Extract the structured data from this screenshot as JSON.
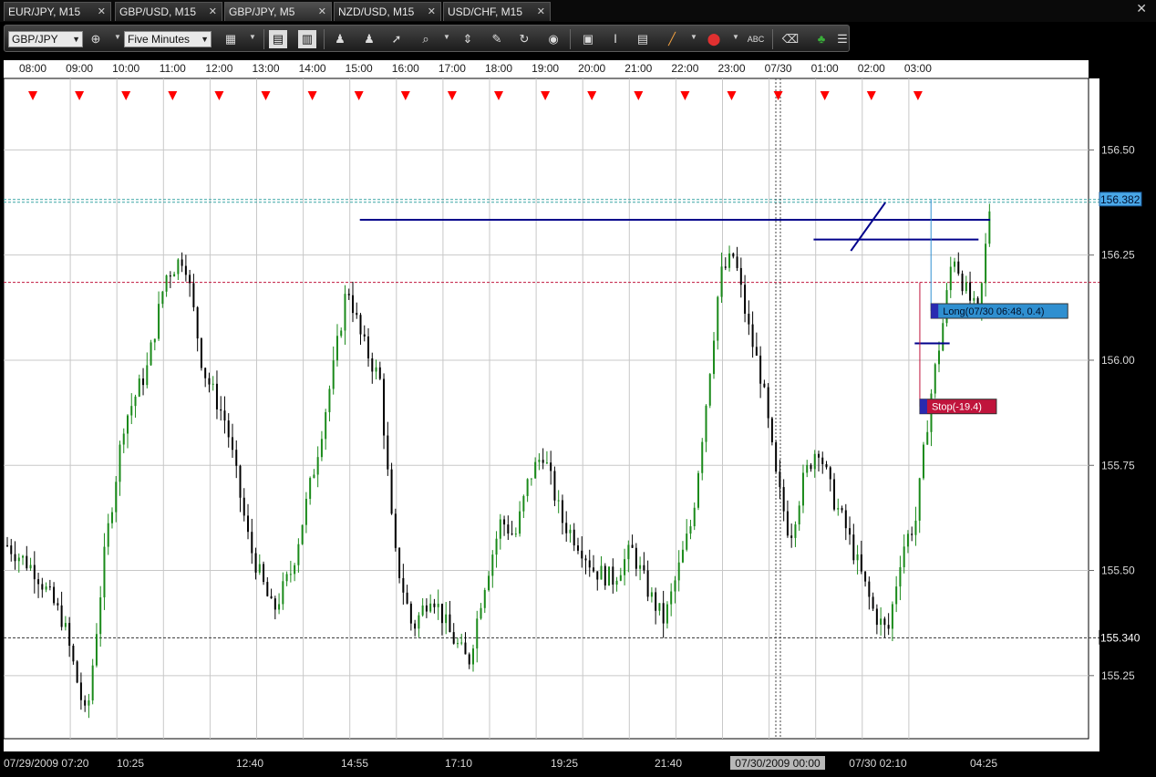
{
  "tabs": [
    {
      "label": "EUR/JPY, M15",
      "close": "✕",
      "active": false
    },
    {
      "label": "GBP/USD, M15",
      "close": "✕",
      "active": false
    },
    {
      "label": "GBP/JPY, M5",
      "close": "✕",
      "active": true
    },
    {
      "label": "NZD/USD, M15",
      "close": "✕",
      "active": false
    },
    {
      "label": "USD/CHF, M15",
      "close": "✕",
      "active": false
    }
  ],
  "window": {
    "close": "✕"
  },
  "toolbar": {
    "symbol": "GBP/JPY",
    "timeframe": "Five Minutes",
    "icons": [
      "crosshair-icon",
      "bar-chart-icon",
      "candle-chart-icon",
      "zoom-in-icon",
      "zoom-out-icon",
      "cursor-icon",
      "magnifier-icon",
      "period-separator-icon",
      "eraser-icon",
      "refresh-icon",
      "globe-icon",
      "image-icon",
      "text-cursor-icon",
      "indicator-list-icon",
      "pencil-line-icon",
      "marker-icon",
      "text-label-icon",
      "clear-icon",
      "tree-icon",
      "menu-icon"
    ]
  },
  "colors": {
    "background": "#000000",
    "plot_background": "#ffffff",
    "bull": "#1a8a1a",
    "bear": "#000000",
    "trendline": "#00008b",
    "current_price": "#2f8fd0",
    "stop": "#c0143c",
    "marker": "#ff0000",
    "grid": "#c8c8c8"
  },
  "chart_data": {
    "type": "candlestick",
    "symbol": "GBP/JPY",
    "period": "M5",
    "ylim": [
      155.1,
      156.67
    ],
    "yticks": [
      156.5,
      156.25,
      156.0,
      155.75,
      155.5,
      155.25
    ],
    "top_time_labels": [
      "08:00",
      "09:00",
      "10:00",
      "11:00",
      "12:00",
      "13:00",
      "14:00",
      "15:00",
      "16:00",
      "17:00",
      "18:00",
      "19:00",
      "20:00",
      "21:00",
      "22:00",
      "23:00",
      "07/30",
      "01:00",
      "02:00",
      "03:00"
    ],
    "bottom_time_labels": [
      "07/29/2009 07:20",
      "10:25",
      "12:40",
      "14:55",
      "17:10",
      "19:25",
      "21:40",
      "07/30/2009 00:00",
      "07/30 02:10",
      "04:25"
    ],
    "price_tags": [
      {
        "label": "156.382",
        "value": 156.382,
        "style": "current"
      },
      {
        "label": "155.340",
        "value": 155.34,
        "style": "level"
      }
    ],
    "reference_levels": [
      {
        "value": 156.382,
        "style": "cyan-dotted"
      },
      {
        "value": 156.185,
        "style": "red-dotted"
      },
      {
        "value": 155.34,
        "style": "black-dotted"
      }
    ],
    "trendlines": [
      {
        "t0": 7.02,
        "p0": 156.334,
        "t1": 20.55,
        "p1": 156.334
      },
      {
        "t0": 16.76,
        "p0": 156.287,
        "t1": 20.3,
        "p1": 156.287
      },
      {
        "t0": 18.93,
        "p0": 156.04,
        "t1": 19.68,
        "p1": 156.04
      },
      {
        "t0": 17.56,
        "p0": 156.26,
        "t1": 18.3,
        "p1": 156.375
      }
    ],
    "orders": [
      {
        "label": "Long(07/30 06:48, 0.4)",
        "value": 156.117,
        "type": "long"
      },
      {
        "label": "Stop(-19.4)",
        "value": 155.89,
        "type": "stop"
      }
    ],
    "session_markers": {
      "count": 20
    },
    "candles_note": "OHLC series approximated from the visible trace",
    "trace": [
      [
        0.0,
        155.56
      ],
      [
        0.6,
        155.5
      ],
      [
        1.2,
        155.38
      ],
      [
        1.7,
        155.14
      ],
      [
        2.1,
        155.55
      ],
      [
        2.5,
        155.85
      ],
      [
        3.0,
        155.98
      ],
      [
        3.4,
        156.2
      ],
      [
        3.8,
        156.25
      ],
      [
        4.2,
        155.98
      ],
      [
        4.7,
        155.85
      ],
      [
        5.2,
        155.56
      ],
      [
        5.7,
        155.4
      ],
      [
        6.1,
        155.5
      ],
      [
        6.6,
        155.75
      ],
      [
        7.0,
        155.98
      ],
      [
        7.3,
        156.18
      ],
      [
        7.6,
        156.05
      ],
      [
        8.0,
        155.95
      ],
      [
        8.3,
        155.55
      ],
      [
        8.7,
        155.36
      ],
      [
        9.1,
        155.45
      ],
      [
        9.5,
        155.35
      ],
      [
        9.9,
        155.28
      ],
      [
        10.2,
        155.45
      ],
      [
        10.6,
        155.62
      ],
      [
        10.9,
        155.58
      ],
      [
        11.2,
        155.72
      ],
      [
        11.5,
        155.78
      ],
      [
        11.9,
        155.62
      ],
      [
        12.3,
        155.56
      ],
      [
        12.6,
        155.5
      ],
      [
        13.0,
        155.48
      ],
      [
        13.4,
        155.55
      ],
      [
        13.8,
        155.44
      ],
      [
        14.1,
        155.38
      ],
      [
        14.4,
        155.5
      ],
      [
        14.7,
        155.62
      ],
      [
        15.0,
        155.9
      ],
      [
        15.3,
        156.2
      ],
      [
        15.6,
        156.25
      ],
      [
        15.9,
        156.08
      ],
      [
        16.2,
        155.95
      ],
      [
        16.5,
        155.72
      ],
      [
        16.8,
        155.58
      ],
      [
        17.1,
        155.72
      ],
      [
        17.4,
        155.8
      ],
      [
        17.7,
        155.68
      ],
      [
        18.0,
        155.6
      ],
      [
        18.3,
        155.5
      ],
      [
        18.6,
        155.4
      ],
      [
        18.9,
        155.35
      ],
      [
        19.2,
        155.55
      ],
      [
        19.5,
        155.62
      ],
      [
        19.8,
        155.9
      ],
      [
        20.1,
        156.1
      ],
      [
        20.3,
        156.26
      ],
      [
        20.55,
        156.17
      ],
      [
        20.85,
        156.1
      ],
      [
        21.1,
        156.38
      ]
    ]
  }
}
